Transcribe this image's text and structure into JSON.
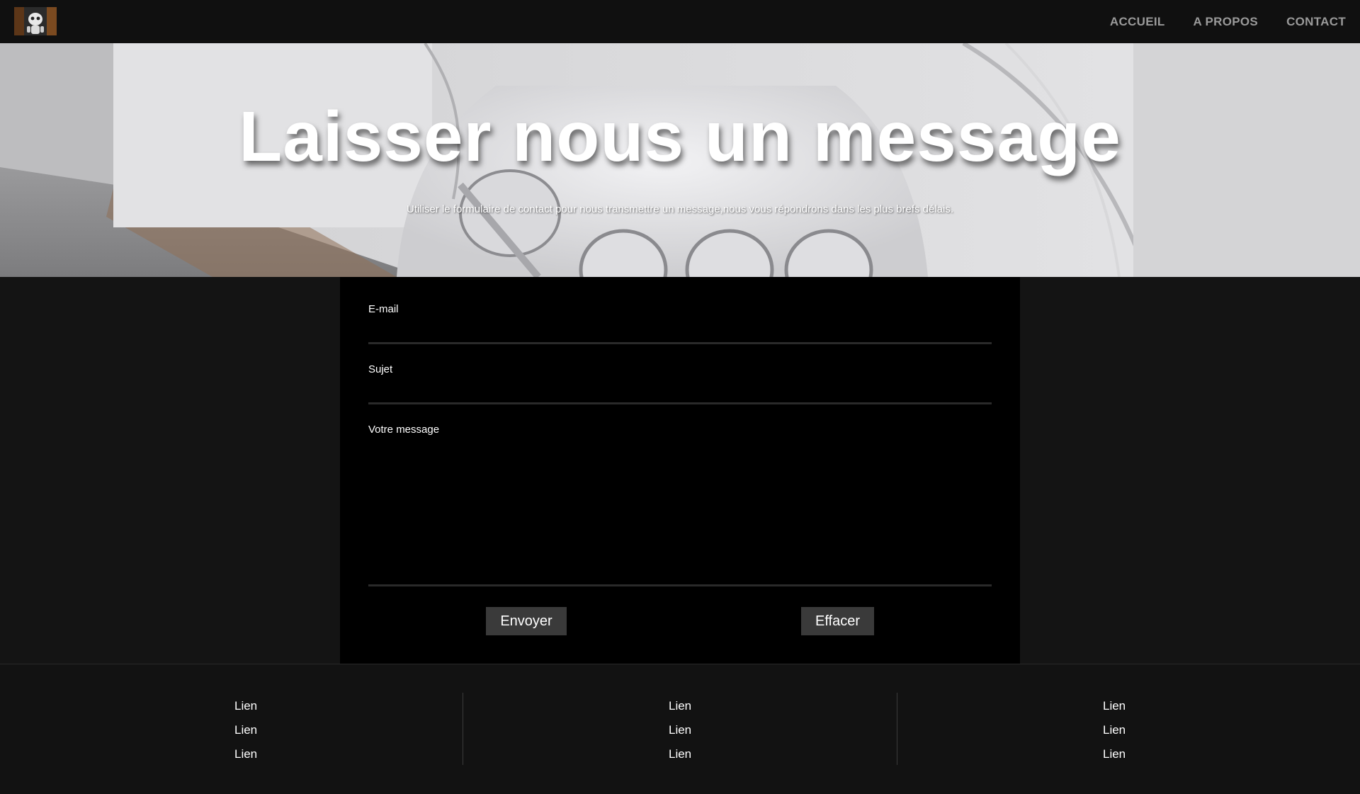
{
  "nav": {
    "logo_icon": "robot-logo-icon",
    "items": [
      "ACCUEIL",
      "A PROPOS",
      "CONTACT"
    ]
  },
  "hero": {
    "title": "Laisser nous un message",
    "subtitle": "Utiliser le formulaire de contact pour nous transmettre un message,nous vous répondrons dans les plus brefs délais."
  },
  "form": {
    "email_label": "E-mail",
    "subject_label": "Sujet",
    "message_label": "Votre message",
    "email_value": "",
    "subject_value": "",
    "message_value": "",
    "submit_label": "Envoyer",
    "reset_label": "Effacer"
  },
  "footer": {
    "columns": [
      {
        "links": [
          "Lien",
          "Lien",
          "Lien"
        ]
      },
      {
        "links": [
          "Lien",
          "Lien",
          "Lien"
        ]
      },
      {
        "links": [
          "Lien",
          "Lien",
          "Lien"
        ]
      }
    ]
  },
  "colors": {
    "page_bg": "#141414",
    "navbar_bg": "#101010",
    "nav_text": "#9a9a9a",
    "form_bg": "#000000",
    "button_bg": "#3a3a3a",
    "text": "#ffffff"
  }
}
